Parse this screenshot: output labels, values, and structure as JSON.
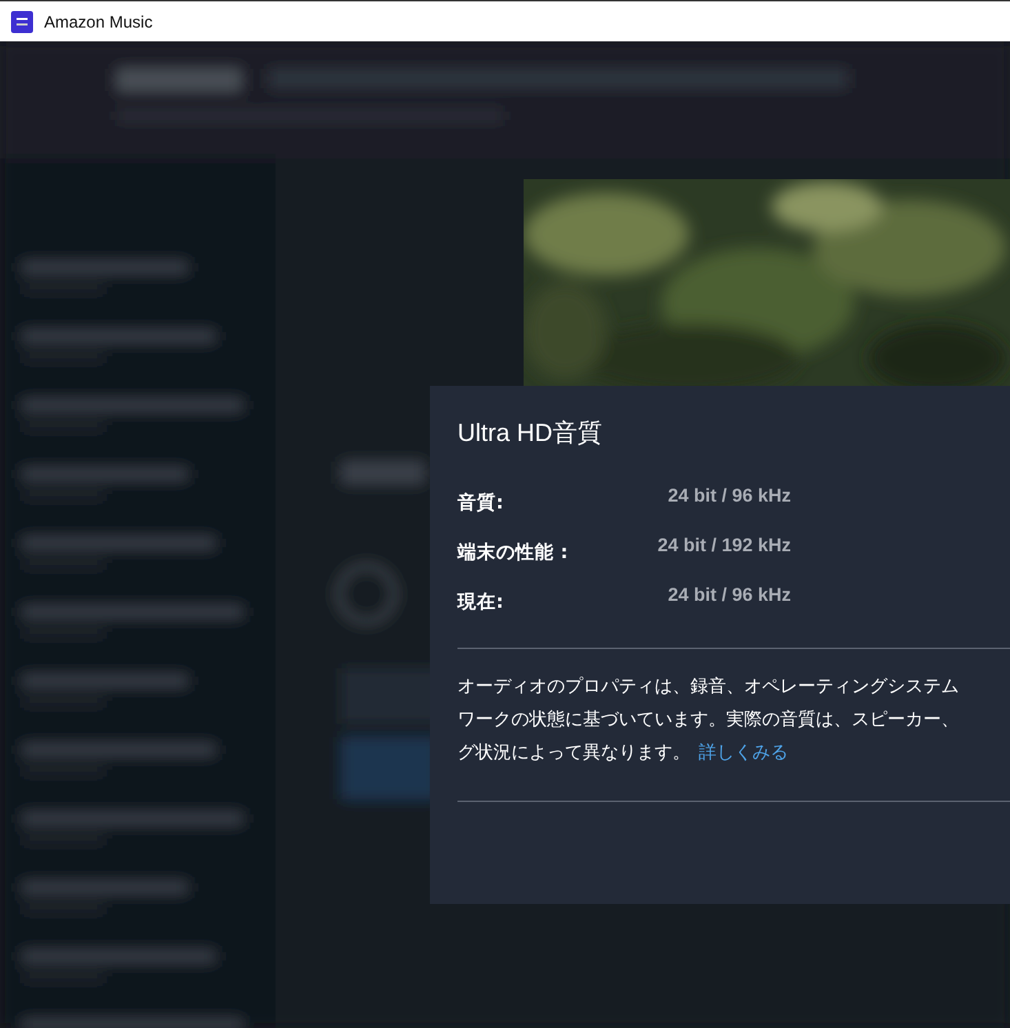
{
  "window": {
    "title": "Amazon Music"
  },
  "dialog": {
    "title": "Ultra HD音質",
    "properties": [
      {
        "label": "音質:",
        "value": "24 bit / 96 kHz"
      },
      {
        "label": "端末の性能 :",
        "value": "24 bit / 192 kHz"
      },
      {
        "label": "現在:",
        "value": "24 bit / 96 kHz"
      }
    ],
    "description_lines": [
      "オーディオのプロパティは、録音、オペレーティングシステム",
      "ワークの状態に基づいています。実際の音質は、スピーカー、",
      "グ状況によって異なります。"
    ],
    "link": "詳しくみる"
  }
}
